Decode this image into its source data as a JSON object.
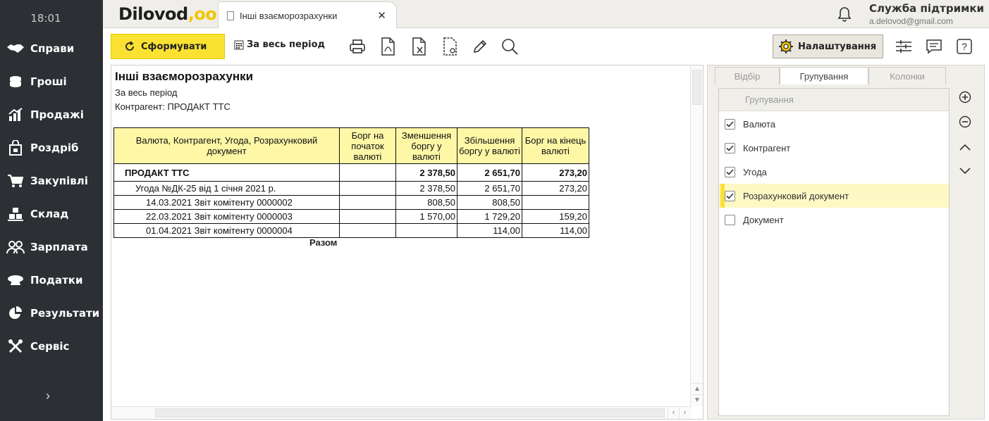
{
  "sidebar": {
    "time": "18:01",
    "items": [
      {
        "label": "Справи",
        "icon": "handshake-icon"
      },
      {
        "label": "Гроші",
        "icon": "coins-icon"
      },
      {
        "label": "Продажі",
        "icon": "sales-chart-icon"
      },
      {
        "label": "Роздріб",
        "icon": "shopping-bag-icon"
      },
      {
        "label": "Закупівлі",
        "icon": "cart-icon"
      },
      {
        "label": "Склад",
        "icon": "boxes-icon"
      },
      {
        "label": "Зарплата",
        "icon": "people-icon"
      },
      {
        "label": "Податки",
        "icon": "officer-cap-icon"
      },
      {
        "label": "Результати",
        "icon": "pie-chart-icon"
      },
      {
        "label": "Сервіс",
        "icon": "tools-icon"
      }
    ],
    "expand_icon": "chevron-right-icon"
  },
  "topbar": {
    "logo": "Dilovod",
    "logo_dots": ",oo",
    "tab_title": "Інші взаєморозрахунки",
    "tab_close": "✕",
    "support_title": "Служба підтримки",
    "support_email": "a.delovod@gmail.com"
  },
  "toolbar": {
    "form_label": "Сформувати",
    "period_label": "За весь період",
    "tools": [
      "print-icon",
      "pdf-export-icon",
      "excel-export-icon",
      "document-settings-icon",
      "edit-pencil-icon",
      "search-icon"
    ],
    "settings_label": "Налаштування"
  },
  "report": {
    "title": "Інші взаєморозрахунки",
    "period": "За весь період",
    "counterparty_line": "Контрагент:  ПРОДАКТ ТТС",
    "headers": [
      "Валюта, Контрагент, Угода, Розрахунковий документ",
      "Борг на початок валюті",
      "Зменшення боргу у валюті",
      "Збільшення боргу у валюті",
      "Борг на кінець валюті"
    ],
    "rows": [
      {
        "name": "ПРОДАКТ ТТС",
        "start": "",
        "dec": "2 378,50",
        "inc": "2 651,70",
        "end": "273,20"
      },
      {
        "name": "Угода №ДК-25 від 1 січня 2021 р.",
        "start": "",
        "dec": "2 378,50",
        "inc": "2 651,70",
        "end": "273,20"
      },
      {
        "name": "14.03.2021 Звіт комітенту 0000002",
        "start": "",
        "dec": "808,50",
        "inc": "808,50",
        "end": ""
      },
      {
        "name": "22.03.2021 Звіт комітенту 0000003",
        "start": "",
        "dec": "1 570,00",
        "inc": "1 729,20",
        "end": "159,20"
      },
      {
        "name": "01.04.2021 Звіт комітенту 0000004",
        "start": "",
        "dec": "",
        "inc": "114,00",
        "end": "114,00"
      }
    ],
    "total_label": "Разом"
  },
  "panel": {
    "tabs": [
      "Відбір",
      "Групування",
      "Колонки"
    ],
    "active_tab": "Групування",
    "group_header": "Групування",
    "groups": [
      {
        "label": "Валюта",
        "checked": true,
        "selected": false
      },
      {
        "label": "Контрагент",
        "checked": true,
        "selected": false
      },
      {
        "label": "Угода",
        "checked": true,
        "selected": false
      },
      {
        "label": "Розрахунковий документ",
        "checked": true,
        "selected": true
      },
      {
        "label": "Документ",
        "checked": false,
        "selected": false
      }
    ],
    "side_buttons": [
      "add-circle-icon",
      "remove-circle-icon",
      "chevron-up-icon",
      "chevron-down-icon"
    ]
  },
  "colors": {
    "sidebar_bg": "#2c2f33",
    "accent_yellow": "#fbe232",
    "header_yellow": "#fdf7a6",
    "selected_row": "#fdf8c4"
  }
}
